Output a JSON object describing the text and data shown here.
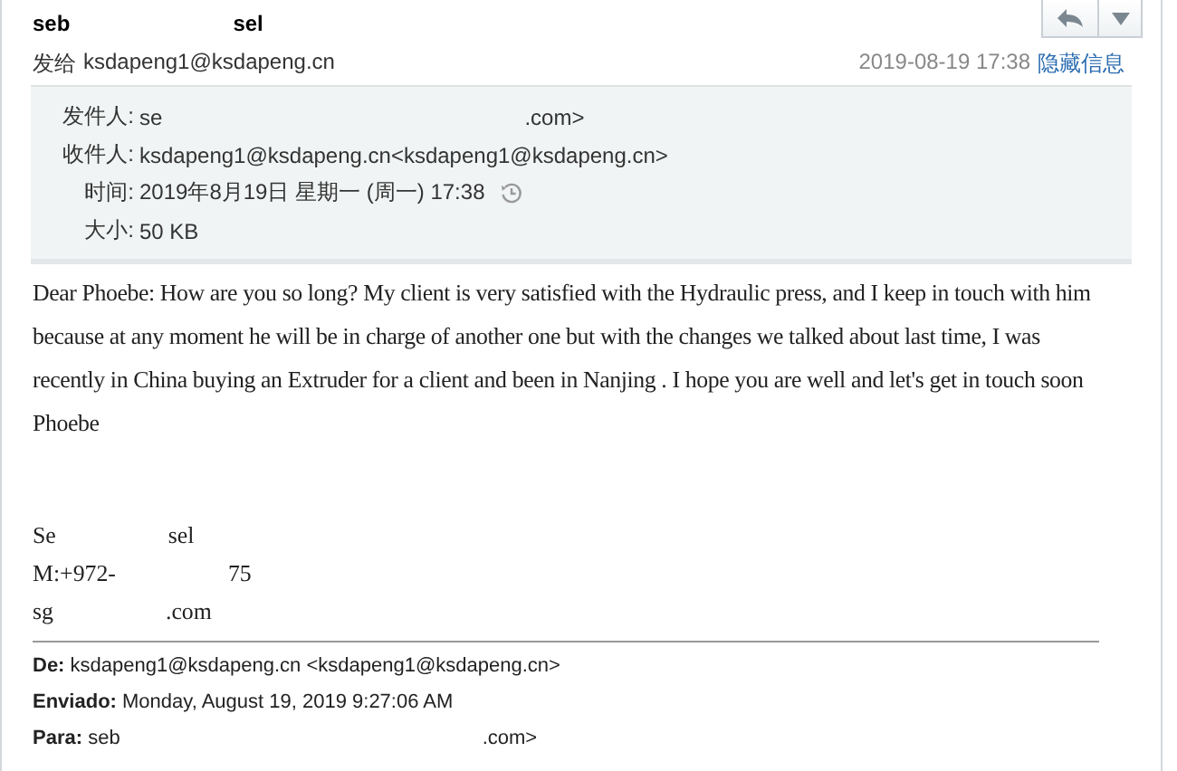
{
  "sender": {
    "name_parts": [
      "seb",
      "sel"
    ]
  },
  "recipient_line": {
    "label": "发给",
    "address": "ksdapeng1@ksdapeng.cn"
  },
  "date": "2019-08-19 17:38",
  "toggle_link": "隐藏信息",
  "details": [
    {
      "label": "发件人:",
      "value_parts": [
        "se",
        ".com>"
      ]
    },
    {
      "label": "收件人:",
      "value_parts": [
        "ksdapeng1@ksdapeng.cn<ksdapeng1@ksdapeng.cn>"
      ]
    },
    {
      "label": "时间:",
      "value_parts": [
        "2019年8月19日 星期一 (周一) 17:38"
      ],
      "history_icon": true
    },
    {
      "label": "大小:",
      "value_parts": [
        "50 KB"
      ]
    }
  ],
  "body": "Dear Phoebe: How are you so long? My client is very satisfied with the Hydraulic press, and I keep in touch with him because at any moment he will be in charge of another one but with the changes we talked about last time, I was recently in China buying an Extruder for a client and been in Nanjing . I hope you are well and let's get in touch soon Phoebe",
  "signature": [
    {
      "parts": [
        "Se",
        "sel"
      ]
    },
    {
      "parts": [
        "M:+972-",
        "75"
      ]
    },
    {
      "parts": [
        "sg",
        ".com"
      ]
    }
  ],
  "quoted_header": [
    {
      "label": "De:",
      "value_parts": [
        "ksdapeng1@ksdapeng.cn <ksdapeng1@ksdapeng.cn>"
      ]
    },
    {
      "label": "Enviado:",
      "value_parts": [
        "Monday, August 19, 2019 9:27:06 AM"
      ]
    },
    {
      "label": "Para:",
      "value_parts": [
        "seb",
        ".com>"
      ]
    }
  ]
}
